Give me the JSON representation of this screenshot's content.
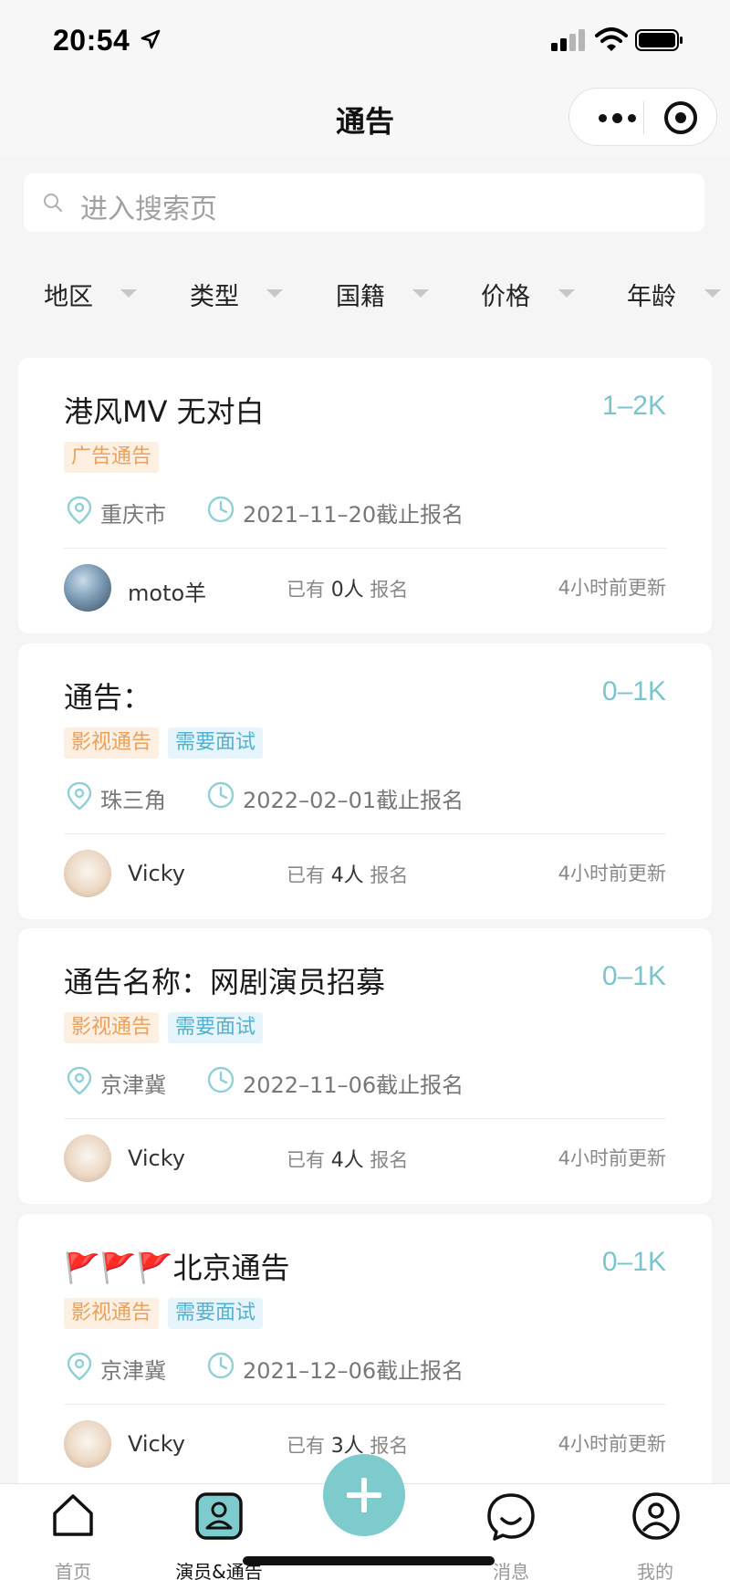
{
  "status_bar": {
    "time": "20:54"
  },
  "nav": {
    "title": "通告"
  },
  "search": {
    "placeholder": "进入搜索页"
  },
  "filters": [
    "地区",
    "类型",
    "国籍",
    "价格",
    "年龄"
  ],
  "cards": [
    {
      "title": "港风MV 无对白",
      "price": "1–2K",
      "tags": [
        {
          "text": "广告通告",
          "color": "orange"
        }
      ],
      "location": "重庆市",
      "deadline": "2021–11–20截止报名",
      "user": "moto羊",
      "signup_prefix": "已有",
      "signup_count": "0人",
      "signup_suffix": "报名",
      "updated": "4小时前更新",
      "avatar": "moto"
    },
    {
      "title": "通告：",
      "price": "0–1K",
      "tags": [
        {
          "text": "影视通告",
          "color": "orange"
        },
        {
          "text": "需要面试",
          "color": "blue"
        }
      ],
      "location": "珠三角",
      "deadline": "2022–02–01截止报名",
      "user": "Vicky",
      "signup_prefix": "已有",
      "signup_count": "4人",
      "signup_suffix": "报名",
      "updated": "4小时前更新",
      "avatar": "vicky"
    },
    {
      "title": "通告名称：网剧演员招募",
      "price": "0–1K",
      "tags": [
        {
          "text": "影视通告",
          "color": "orange"
        },
        {
          "text": "需要面试",
          "color": "blue"
        }
      ],
      "location": "京津冀",
      "deadline": "2022–11–06截止报名",
      "user": "Vicky",
      "signup_prefix": "已有",
      "signup_count": "4人",
      "signup_suffix": "报名",
      "updated": "4小时前更新",
      "avatar": "vicky"
    },
    {
      "title": "🚩🚩🚩北京通告",
      "price": "0–1K",
      "tags": [
        {
          "text": "影视通告",
          "color": "orange"
        },
        {
          "text": "需要面试",
          "color": "blue"
        }
      ],
      "location": "京津冀",
      "deadline": "2021–12–06截止报名",
      "user": "Vicky",
      "signup_prefix": "已有",
      "signup_count": "3人",
      "signup_suffix": "报名",
      "updated": "4小时前更新",
      "avatar": "vicky"
    }
  ],
  "tabbar": {
    "home": "首页",
    "talent": "演员&通告",
    "messages": "消息",
    "mine": "我的"
  },
  "colors": {
    "accent": "#7ecbcd",
    "price": "#7cc4cc",
    "tag_orange": "#e9a15b",
    "tag_blue": "#55b0d0"
  }
}
